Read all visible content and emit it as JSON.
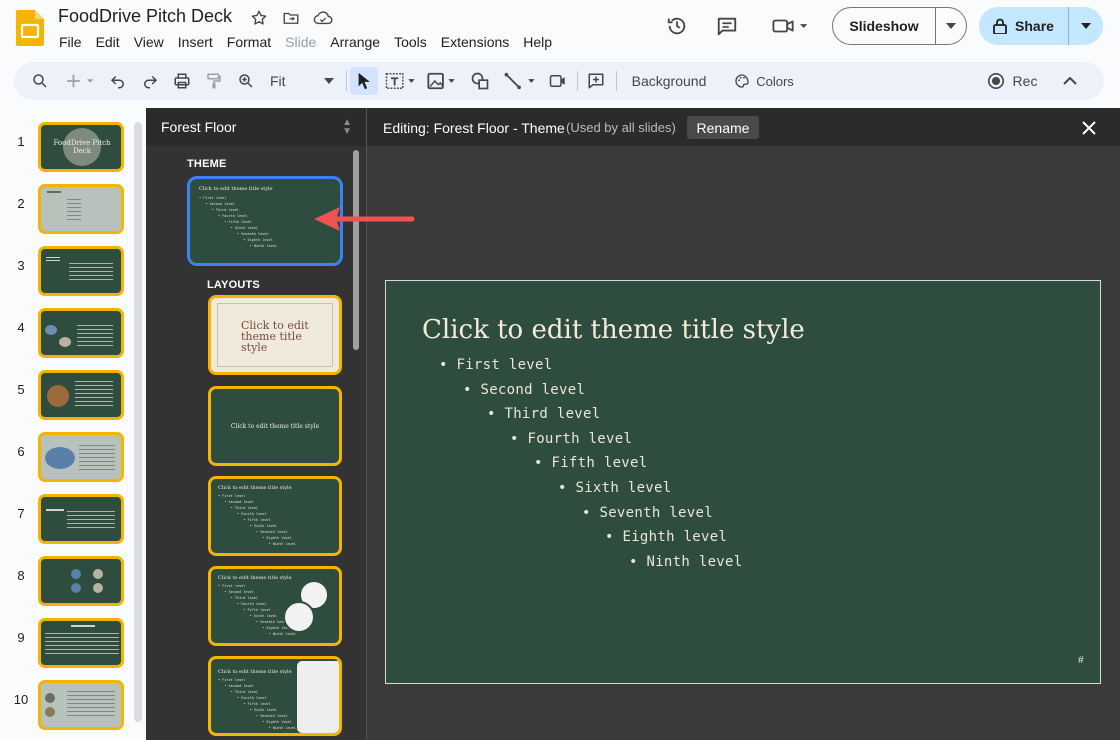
{
  "header": {
    "doc_title": "FoodDrive Pitch Deck",
    "menu": [
      "File",
      "Edit",
      "View",
      "Insert",
      "Format",
      "Slide",
      "Arrange",
      "Tools",
      "Extensions",
      "Help"
    ],
    "disabled_menu": "Slide",
    "slideshow_label": "Slideshow",
    "share_label": "Share"
  },
  "toolbar": {
    "zoom_label": "Fit",
    "background_label": "Background",
    "colors_label": "Colors",
    "rec_label": "Rec"
  },
  "filmstrip": {
    "slides": [
      {
        "num": "1",
        "style": "dark"
      },
      {
        "num": "2",
        "style": "light"
      },
      {
        "num": "3",
        "style": "dark"
      },
      {
        "num": "4",
        "style": "dark"
      },
      {
        "num": "5",
        "style": "dark"
      },
      {
        "num": "6",
        "style": "light"
      },
      {
        "num": "7",
        "style": "dark"
      },
      {
        "num": "8",
        "style": "dark"
      },
      {
        "num": "9",
        "style": "dark"
      },
      {
        "num": "10",
        "style": "light"
      }
    ],
    "slide1_text": "FoodDrive Pitch Deck"
  },
  "theme_panel": {
    "title": "Forest Floor",
    "theme_label": "THEME",
    "layouts_label": "LAYOUTS",
    "layout_title_text": "Click to edit theme title style"
  },
  "editor": {
    "title": "Editing: Forest Floor - Theme",
    "used_note": "(Used by all slides)",
    "rename_label": "Rename",
    "slide_title": "Click to edit theme title style",
    "bullets": [
      "First level",
      "Second level",
      "Third level",
      "Fourth level",
      "Fifth level",
      "Sixth level",
      "Seventh level",
      "Eighth level",
      "Ninth level"
    ],
    "footer_mark": "#"
  },
  "colors": {
    "accent_blue": "#3b82f6",
    "highlight_yellow": "#f4b400",
    "slide_green": "#2f4d3e",
    "arrow_red": "#f05252"
  }
}
